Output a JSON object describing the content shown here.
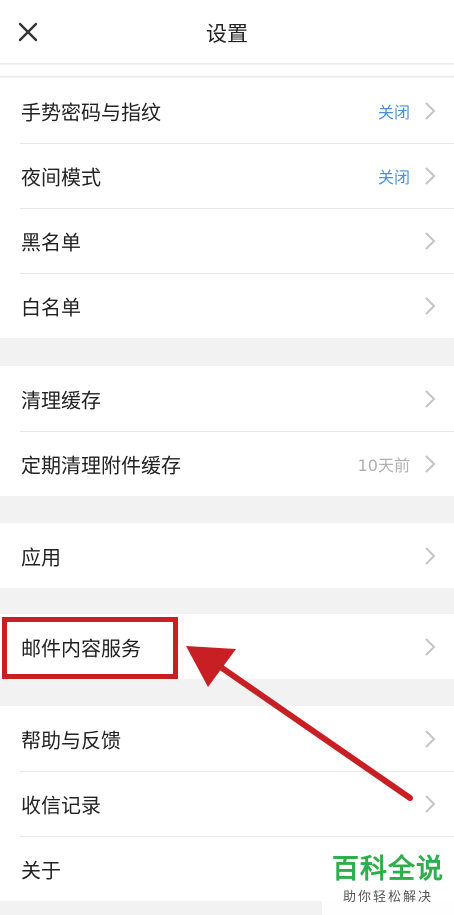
{
  "header": {
    "title": "设置",
    "close_icon": "close-icon"
  },
  "groups": [
    {
      "items": [
        {
          "label": "手势密码与指纹",
          "value": "关闭"
        },
        {
          "label": "夜间模式",
          "value": "关闭"
        },
        {
          "label": "黑名单",
          "value": ""
        },
        {
          "label": "白名单",
          "value": ""
        }
      ]
    },
    {
      "items": [
        {
          "label": "清理缓存",
          "value": ""
        },
        {
          "label": "定期清理附件缓存",
          "value": "10天前"
        }
      ]
    },
    {
      "items": [
        {
          "label": "应用",
          "value": ""
        }
      ]
    },
    {
      "items": [
        {
          "label": "邮件内容服务",
          "value": ""
        }
      ]
    },
    {
      "items": [
        {
          "label": "帮助与反馈",
          "value": ""
        },
        {
          "label": "收信记录",
          "value": ""
        },
        {
          "label": "关于",
          "value": ""
        }
      ]
    }
  ],
  "annotation": {
    "color": "#c81f24",
    "highlighted_item": "邮件内容服务"
  },
  "watermark": {
    "title": "百科全说",
    "subtitle": "助你轻松解决",
    "color": "#2fae4c"
  },
  "colors": {
    "accent": "#4a90d9",
    "muted": "#b0b0b0",
    "background": "#f2f2f2"
  }
}
